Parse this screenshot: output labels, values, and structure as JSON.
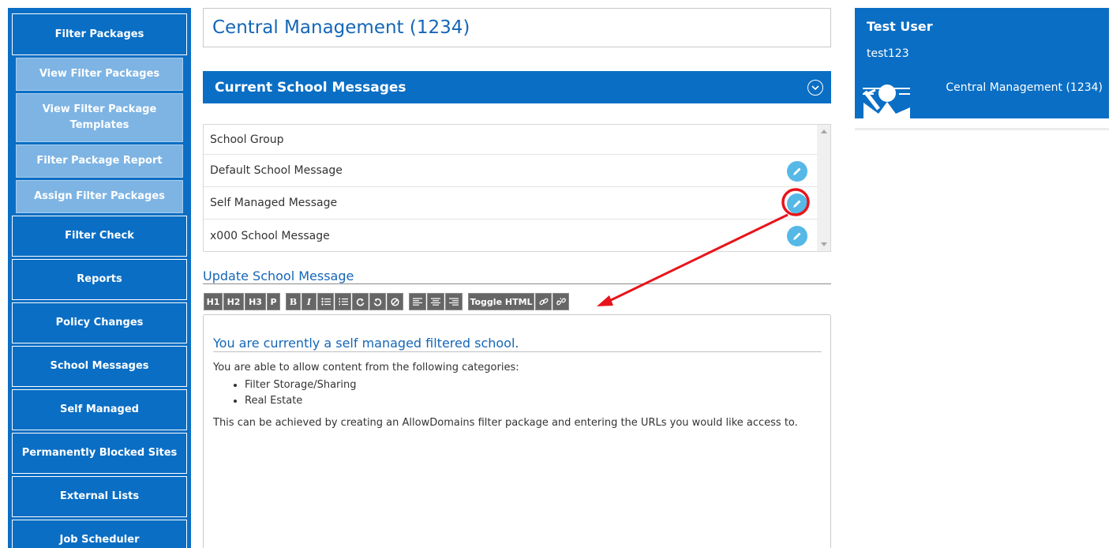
{
  "sidebar": {
    "items": [
      {
        "label": "Filter Packages"
      },
      {
        "label": "View Filter Packages"
      },
      {
        "label": "View Filter Package Templates"
      },
      {
        "label": "Filter Package Report"
      },
      {
        "label": "Assign Filter Packages"
      },
      {
        "label": "Filter Check"
      },
      {
        "label": "Reports"
      },
      {
        "label": "Policy Changes"
      },
      {
        "label": "School Messages"
      },
      {
        "label": "Self Managed"
      },
      {
        "label": "Permanently Blocked Sites"
      },
      {
        "label": "External Lists"
      },
      {
        "label": "Job Scheduler"
      }
    ]
  },
  "header": {
    "title": "Central Management (1234)"
  },
  "messages_section": {
    "title": "Current School Messages",
    "rows": [
      {
        "label": "School Group"
      },
      {
        "label": "Default School Message"
      },
      {
        "label": "Self Managed Message"
      },
      {
        "label": "x000 School Message"
      }
    ]
  },
  "update": {
    "title": "Update School Message",
    "toolbar": {
      "h1": "H1",
      "h2": "H2",
      "h3": "H3",
      "p": "P",
      "bold": "B",
      "italic": "I",
      "toggle_html": "Toggle HTML"
    },
    "content": {
      "heading": "You are currently a self managed filtered school.",
      "intro": "You are able to allow content from the following categories:",
      "categories": [
        "Filter Storage/Sharing",
        "Real Estate"
      ],
      "outro": "This can be achieved by creating an AllowDomains filter package and entering the URLs you would like access to."
    }
  },
  "user": {
    "name": "Test User",
    "id": "test123",
    "org": "Central Management (1234)"
  },
  "colors": {
    "brand": "#0a6ec4",
    "sub_item": "#7db4e4",
    "edit_button": "#56b8e6",
    "annotation": "#e8141b"
  }
}
